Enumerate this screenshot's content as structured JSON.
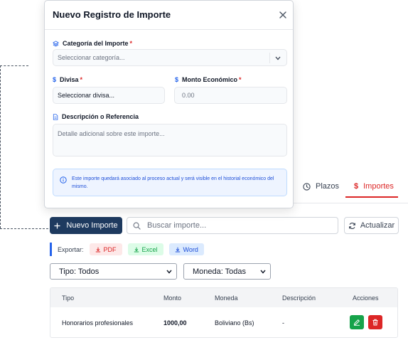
{
  "modal": {
    "title": "Nuevo Registro de Importe",
    "categoria": {
      "label": "Categoría del Importe",
      "required_mark": "*",
      "placeholder": "Seleccionar categoría..."
    },
    "divisa": {
      "label": "Divisa",
      "required_mark": "*",
      "value": "Seleccionar divisa..."
    },
    "monto": {
      "label": "Monto Económico",
      "required_mark": "*",
      "placeholder": "0.00"
    },
    "descripcion": {
      "label": "Descripción o Referencia",
      "placeholder": "Detalle adicional sobre este importe..."
    },
    "info_text": "Este importe quedará asociado al proceso actual y será visible en el historial económico del mismo."
  },
  "tabs": [
    {
      "label": "Plazos",
      "icon": "clock-icon",
      "active": false
    },
    {
      "label": "Importes",
      "icon": "dollar-icon",
      "active": true
    }
  ],
  "toolbar": {
    "new_button": "Nuevo Importe",
    "search_placeholder": "Buscar importe...",
    "refresh_button": "Actualizar"
  },
  "export": {
    "label": "Exportar:",
    "pdf": "PDF",
    "excel": "Excel",
    "word": "Word"
  },
  "filters": {
    "tipo": "Tipo: Todos",
    "moneda": "Moneda: Todas"
  },
  "table": {
    "headers": [
      "Tipo",
      "Monto",
      "Moneda",
      "Descripción",
      "Acciones"
    ],
    "rows": [
      {
        "tipo": "Honorarios profesionales",
        "monto": "1000,00",
        "moneda": "Boliviano (Bs)",
        "descripcion": "-"
      }
    ]
  },
  "colors": {
    "primary": "#1e3a5f",
    "accent_red": "#dc2626",
    "accent_green": "#16a34a",
    "accent_blue": "#2563eb"
  }
}
